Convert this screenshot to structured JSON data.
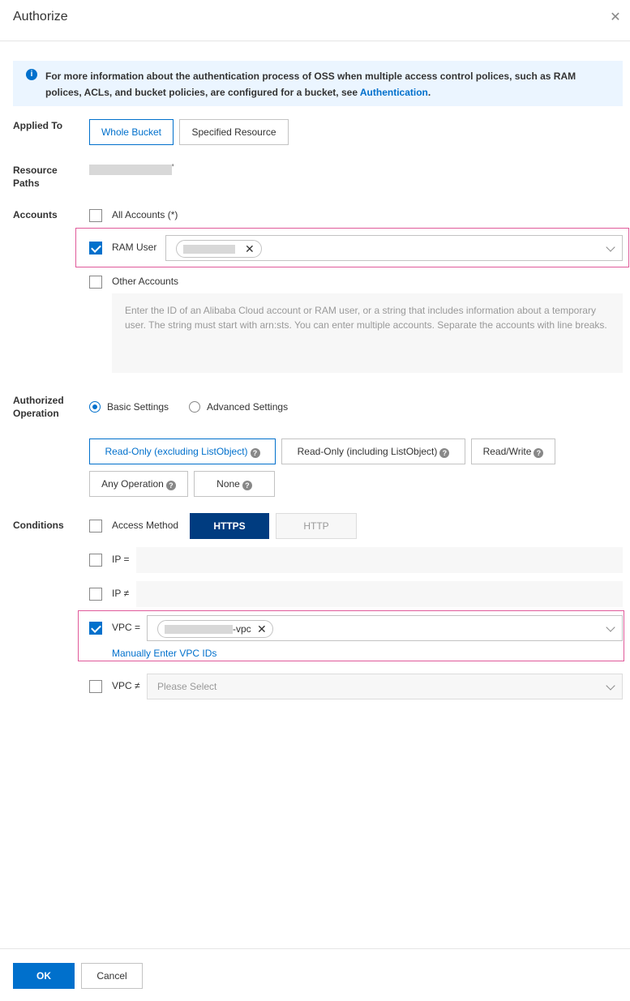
{
  "dialog": {
    "title": "Authorize",
    "close_icon": "close-icon"
  },
  "notice": {
    "icon": "info-icon",
    "text": "For more information about the authentication process of OSS when multiple access control polices, such as RAM polices, ACLs, and bucket policies, are configured for a bucket, see",
    "link_text": "Authentication",
    "suffix": "."
  },
  "applied_to": {
    "label": "Applied To",
    "options": [
      "Whole Bucket",
      "Specified Resource"
    ],
    "selected": "Whole Bucket"
  },
  "resource_paths": {
    "label": "Resource Paths",
    "suffix": "'"
  },
  "accounts": {
    "label": "Accounts",
    "all_accounts": {
      "label": "All Accounts (*)",
      "checked": false
    },
    "ram_user": {
      "label": "RAM User",
      "checked": true
    },
    "other_accounts": {
      "label": "Other Accounts",
      "checked": false
    },
    "other_placeholder": "Enter the ID of an Alibaba Cloud account or RAM user, or a string that includes information about a temporary user. The string must start with arn:sts. You can enter multiple accounts. Separate the accounts with line breaks."
  },
  "authorized_operation": {
    "label": "Authorized Operation",
    "modes": [
      "Basic Settings",
      "Advanced Settings"
    ],
    "selected_mode": "Basic Settings",
    "operations": [
      "Read-Only (excluding ListObject)",
      "Read-Only (including ListObject)",
      "Read/Write",
      "Any Operation",
      "None"
    ],
    "selected_operation": "Read-Only (excluding ListObject)"
  },
  "conditions": {
    "label": "Conditions",
    "access_method": {
      "label": "Access Method",
      "checked": false,
      "options": [
        "HTTPS",
        "HTTP"
      ],
      "selected": "HTTPS"
    },
    "ip_eq": {
      "label": "IP =",
      "checked": false
    },
    "ip_neq": {
      "label": "IP ≠",
      "checked": false
    },
    "vpc_eq": {
      "label": "VPC =",
      "checked": true,
      "tag_suffix": "-vpc"
    },
    "manual_vpc_link": "Manually Enter VPC IDs",
    "vpc_neq": {
      "label": "VPC ≠",
      "checked": false,
      "placeholder": "Please Select"
    }
  },
  "footer": {
    "ok_label": "OK",
    "cancel_label": "Cancel"
  },
  "colors": {
    "accent": "#0070cc",
    "dark_toggle": "#003c80",
    "highlight": "#e05a9a",
    "notice_bg": "#ebf5ff"
  }
}
